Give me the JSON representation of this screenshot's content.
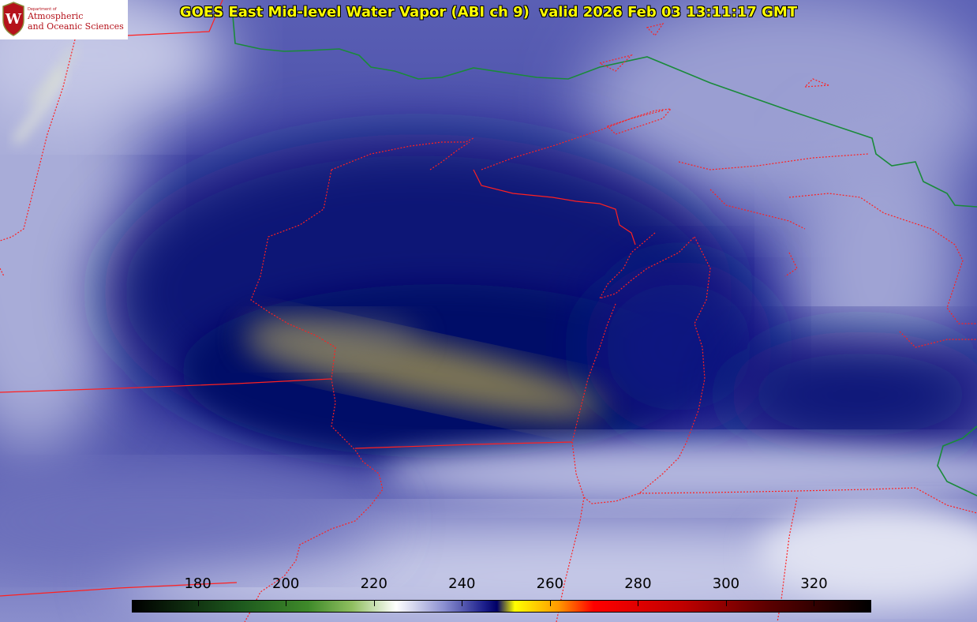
{
  "title": "GOES East Mid-level Water Vapor (ABI ch 9)  valid 2026 Feb 03 13:11:17 GMT",
  "logo": {
    "department": "Department of",
    "line1": "Atmospheric",
    "line2": "and Oceanic Sciences",
    "crest_letter": "W",
    "color": "#b5121b"
  },
  "colorbar": {
    "min": 165,
    "max": 333,
    "ticks": [
      "180",
      "200",
      "220",
      "240",
      "260",
      "280",
      "300",
      "320"
    ],
    "tick_values": [
      180,
      200,
      220,
      240,
      260,
      280,
      300,
      320
    ],
    "stops": [
      {
        "value": 165,
        "color": "#000000"
      },
      {
        "value": 190,
        "color": "#1e5a1e"
      },
      {
        "value": 205,
        "color": "#3f8a2a"
      },
      {
        "value": 215,
        "color": "#8fbf60"
      },
      {
        "value": 225,
        "color": "#ffffff"
      },
      {
        "value": 236,
        "color": "#8a8ed0"
      },
      {
        "value": 245,
        "color": "#1c1f8c"
      },
      {
        "value": 248,
        "color": "#000066"
      },
      {
        "value": 252,
        "color": "#ffff00"
      },
      {
        "value": 262,
        "color": "#ff9900"
      },
      {
        "value": 270,
        "color": "#ff0000"
      },
      {
        "value": 290,
        "color": "#c00000"
      },
      {
        "value": 310,
        "color": "#5a0000"
      },
      {
        "value": 333,
        "color": "#000000"
      }
    ]
  },
  "map_colors": {
    "state_borders": "#ff2020",
    "country_border": "#1a8a3a",
    "moist": "#b8bce0",
    "dry": "#0a1270",
    "very_dry": "#c8b860"
  }
}
